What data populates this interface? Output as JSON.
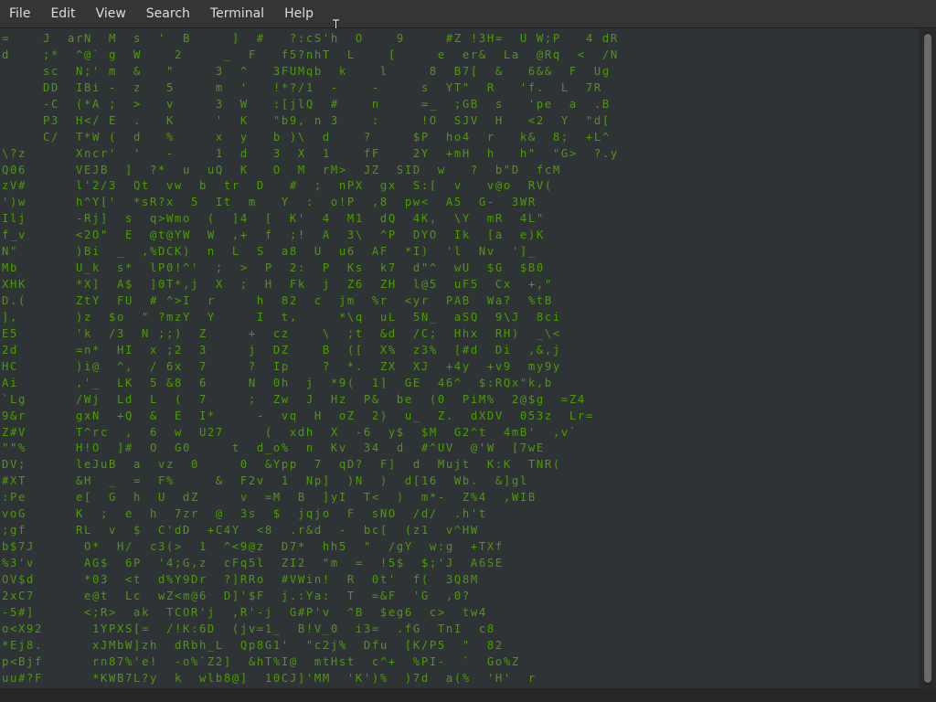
{
  "menubar": {
    "items": [
      "File",
      "Edit",
      "View",
      "Search",
      "Terminal",
      "Help"
    ]
  },
  "icons": {
    "cursor": "text-cursor-icon"
  },
  "colors": {
    "terminal_bg": "#2e3436",
    "rain_green": "#4e9a06",
    "rain_head": "#e6e6e6",
    "menubar_bg": "#353535"
  },
  "terminal": {
    "lines": [
      "=    J  arN  M  s  '  B     ]  #   ?:cS'h  O    9     #Z !3H=  U W;P   4 dR",
      "d    ;*  ^@` g  W    2     _  F   f5?nhT  L    [     e  er&  La  @Rq  <  /N",
      "     sc  N;' m  &   \"     3  ^   3FUMqb  k    l     8  B7[  &   6&&  F  Ug",
      "     DD  IBi -  z   5     m  '   !*?/1  -    -     s  YT\"  R   'f.  L  7R",
      "     -C  (*A ;  >   v     3  W   :[jlQ  #    n     =_  ;GB  s   'pe  a  .B",
      "     P3  H</ E  .   K     '  K   \"b9, n 3    :     !O  SJV  H   <2  Y  \"d[",
      "     C/  T*W (  d   %     x  y   b )\\  d    ?     $P  ho4  r   k&  8;  +L^",
      "\\?z      Xncr'  '   -     1  d   3  X  1    fF    2Y  +mH  h   h\"  \"G>  ?.y",
      "Q06      VEJB  ]  ?*  u  uQ  K   O  M  rM>  JZ  SID  w   ?  b\"D  fcM",
      "zV#      l'2/3  Qt  vw  b  tr  D   #  ;  nPX  gx  S:[  v   v@o  RV(",
      "')w      h^Y['  *sR?x  5  It  m   Y  :  o!P  ,8  pw<  A5  G-  3WR",
      "Ilj      -Rj]  s  q>Wmo  (  ]4  [  K'  4  M1  dQ  4K,  \\Y  mR  4L\"",
      "f_v      <2O\"  E  @t@YW  W  ,+  f  ;!  A  3\\  ^P  DYO  Ik  [a  e)K",
      "N\"       )Bi  _  ,%DCK)  n  L  S  a8  U  u6  AF  *I)  'l  Nv  ']_",
      "Mb       U_k  s*  lP0!^'  ;  >  P  2:  P  Ks  k7  d\"^  wU  $G  $B0",
      "XHK      *X]  A$  ]0T*,j  X  ;  H  Fk  j  Z6  ZH  l@5  uF5  Cx  +,\"",
      "D.(      ZtY  FU  # ^>I  r     h  82  c  jm  %r  <yr  PAB  Wa?  %tB",
      "],       )z  $o  \" ?mzY  Y     I  t,     *\\q  uL  5N_  aSQ  9\\J  8ci",
      "E5       'k  /3  N ;;)  Z     +  cz    \\  ;t  &d  /C;  Hhx  RH)  _\\<",
      "2d       =n*  HI  x ;2  3     j  DZ    B  ([  X%  z3%  [#d  Di  ,&,j",
      "HC       )i@  ^,  / 6x  7     ?  Ip    ?  *.  ZX  XJ  +4y  +v9  my9y",
      "Ai       ,'_  LK  5 &8  6     N  0h  j  *9(  1]  GE  46^  $:RQx\"k,b",
      "`Lg      /Wj  Ld  L  (  7     ;  Zw  J  Hz  P&  be  (0  PiM%  2@$g  =Z4",
      "9&r      gxN  +Q  &  E  I*     -  vq  H  oZ  2)  u_  Z.  dXDV  053z  Lr=",
      "Z#V      T^rc  ,  6  w  U27     (  xdh  X  -6  y$  $M  G2^t  4mB'  ,v`",
      "\"\"%      H!O  ]#  O  G0     t  d_o%  n  Kv  34  d  #^UV  @'W  [7wE",
      "DV;      leJuB  a  vz  0     0  &Ypp  7  qD?  F]  d  Mujt  K:K  TNR(",
      "#XT      &H  _  =  F%     &  F2v  1  Np]  )N  )  d[16  Wb.  &]gl",
      ":Pe      e[  G  h  U  dZ     v  =M  B  ]yI  T<  )  m*-  Z%4  ,WIB",
      "voG      K  ;  e  h  7zr  @  3s  $  jqjo  F  sNO  /d/  .h't",
      ";gf      RL  v  $  C'dD  +C4Y  <8  .r&d  -  bc[  (z1  v^HW",
      "b$7J      O*  H/  c3(>  1  ^<9@z  D7*  hh5  \"  /gY  w:g  +TXf",
      "%3'v      AG$  6P  '4;G,z  cFq5l  ZI2  \"m  =  !5$  $;'J  A6SE",
      "OV$d      *03  <t  d%Y9Dr  ?]RRo  #VWin!  R  0t'  f(  3Q8M",
      "2xC7      e@t  Lc  wZ<m@6  D]'$F  j.:Ya:  T  =&F  'G  ,0?",
      "-5#]      <;R>  ak  TCOR'j  ,R'-j  G#P'v  ^B  $eg6  c>  tw4",
      "o<X92      1YPXS[=  /!K:6D  (jv=1_  B!V_0  i3=  .fG  TnI  c8",
      "*Ej8.      xJMbW]zh  dRbh_L  Qp8G1'  \"c2j%  Dfu  [K/P5  \"  82",
      "p<Bjf      rn87%'e!  -o%`Z2]  &hT%I@  mtHst  c^+  %PI-  `  Go%Z",
      "uu#?F      *KWB7L?y  k  wlb8@]  10CJ]'MM  'K')%  )7d  a(%  'H'  r"
    ]
  }
}
